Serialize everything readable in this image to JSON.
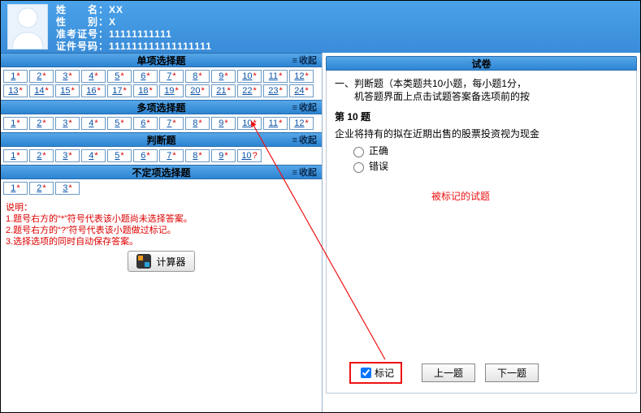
{
  "header": {
    "name_label": "姓　　名：",
    "name_value": "XX",
    "gender_label": "性　　别：",
    "gender_value": "X",
    "admission_label": "准考证号：",
    "admission_value": "11111111111",
    "id_label": "证件号码：",
    "id_value": "111111111111111111"
  },
  "sections": {
    "single": {
      "title": "单项选择题",
      "collapse": "收起"
    },
    "multi": {
      "title": "多项选择题",
      "collapse": "收起"
    },
    "judge": {
      "title": "判断题",
      "collapse": "收起"
    },
    "uncertain": {
      "title": "不定项选择题",
      "collapse": "收起"
    }
  },
  "questions": {
    "single": [
      {
        "n": "1",
        "m": "*"
      },
      {
        "n": "2",
        "m": "*"
      },
      {
        "n": "3",
        "m": "*"
      },
      {
        "n": "4",
        "m": "*"
      },
      {
        "n": "5",
        "m": "*"
      },
      {
        "n": "6",
        "m": "*"
      },
      {
        "n": "7",
        "m": "*"
      },
      {
        "n": "8",
        "m": "*"
      },
      {
        "n": "9",
        "m": "*"
      },
      {
        "n": "10",
        "m": "*"
      },
      {
        "n": "11",
        "m": "*"
      },
      {
        "n": "12",
        "m": "*"
      },
      {
        "n": "13",
        "m": "*"
      },
      {
        "n": "14",
        "m": "*"
      },
      {
        "n": "15",
        "m": "*"
      },
      {
        "n": "16",
        "m": "*"
      },
      {
        "n": "17",
        "m": "*"
      },
      {
        "n": "18",
        "m": "*"
      },
      {
        "n": "19",
        "m": "*"
      },
      {
        "n": "20",
        "m": "*"
      },
      {
        "n": "21",
        "m": "*"
      },
      {
        "n": "22",
        "m": "*"
      },
      {
        "n": "23",
        "m": "*"
      },
      {
        "n": "24",
        "m": "*"
      }
    ],
    "multi": [
      {
        "n": "1",
        "m": "*"
      },
      {
        "n": "2",
        "m": "*"
      },
      {
        "n": "3",
        "m": "*"
      },
      {
        "n": "4",
        "m": "*"
      },
      {
        "n": "5",
        "m": "*"
      },
      {
        "n": "6",
        "m": "*"
      },
      {
        "n": "7",
        "m": "*"
      },
      {
        "n": "8",
        "m": "*"
      },
      {
        "n": "9",
        "m": "*"
      },
      {
        "n": "10",
        "m": "*"
      },
      {
        "n": "11",
        "m": "*"
      },
      {
        "n": "12",
        "m": "*"
      }
    ],
    "judge": [
      {
        "n": "1",
        "m": "*"
      },
      {
        "n": "2",
        "m": "*"
      },
      {
        "n": "3",
        "m": "*"
      },
      {
        "n": "4",
        "m": "*"
      },
      {
        "n": "5",
        "m": "*"
      },
      {
        "n": "6",
        "m": "*"
      },
      {
        "n": "7",
        "m": "*"
      },
      {
        "n": "8",
        "m": "*"
      },
      {
        "n": "9",
        "m": "*"
      },
      {
        "n": "10",
        "m": "?"
      }
    ],
    "uncertain": [
      {
        "n": "1",
        "m": "*"
      },
      {
        "n": "2",
        "m": "*"
      },
      {
        "n": "3",
        "m": "*"
      }
    ]
  },
  "notes": {
    "header": "说明：",
    "line1": "1.题号右方的“*”符号代表该小题尚未选择答案。",
    "line2": "2.题号右方的“?”符号代表该小题做过标记。",
    "line3": "3.选择选项的同时自动保存答案。"
  },
  "calc": {
    "label": "计算器"
  },
  "right": {
    "bar_title": "试卷",
    "desc_line1": "一、判断题（本类题共10小题，每小题1分，",
    "desc_line2": "机答题界面上点击试题答案备选项前的按",
    "q_title": "第 10 题",
    "q_text": "企业将持有的拟在近期出售的股票投资视为现金",
    "opt_true": "正确",
    "opt_false": "错误"
  },
  "bottom": {
    "mark_label": "标记",
    "prev": "上一题",
    "next": "下一题"
  },
  "annotation": {
    "label": "被标记的试题"
  }
}
